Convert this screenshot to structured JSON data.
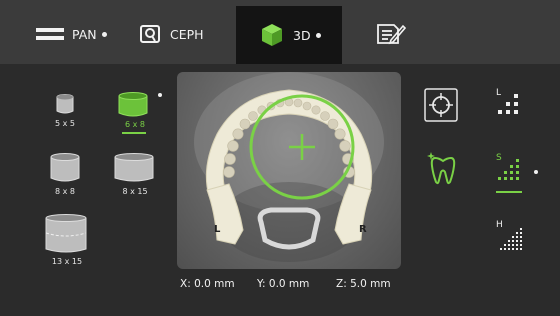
{
  "tabs": [
    {
      "label": "PAN",
      "icon": "panoramic-icon",
      "selected": false,
      "has_dot": true
    },
    {
      "label": "CEPH",
      "icon": "ceph-icon",
      "selected": false,
      "has_dot": false
    },
    {
      "label": "3D",
      "icon": "cube-icon",
      "selected": true,
      "has_dot": true
    },
    {
      "label": "",
      "icon": "notes-edit-icon",
      "selected": false,
      "has_dot": false
    }
  ],
  "volumes": [
    {
      "label": "5 x 5",
      "selected": false
    },
    {
      "label": "6 x 8",
      "selected": true
    },
    {
      "label": "8 x 8",
      "selected": false
    },
    {
      "label": "8 x 15",
      "selected": false
    },
    {
      "label": "13 x 15",
      "selected": false
    }
  ],
  "viewer": {
    "left_marker": "L",
    "right_marker": "R"
  },
  "coordinates": {
    "x": "X: 0.0 mm",
    "y": "Y: 0.0 mm",
    "z": "Z: 5.0 mm"
  },
  "resolution": {
    "low": "L",
    "standard": "S",
    "high": "H",
    "selected": "S"
  },
  "colors": {
    "accent": "#7ad146",
    "topbar": "#3b3b3b",
    "background": "#2b2b2b",
    "active_tab": "#141414"
  }
}
